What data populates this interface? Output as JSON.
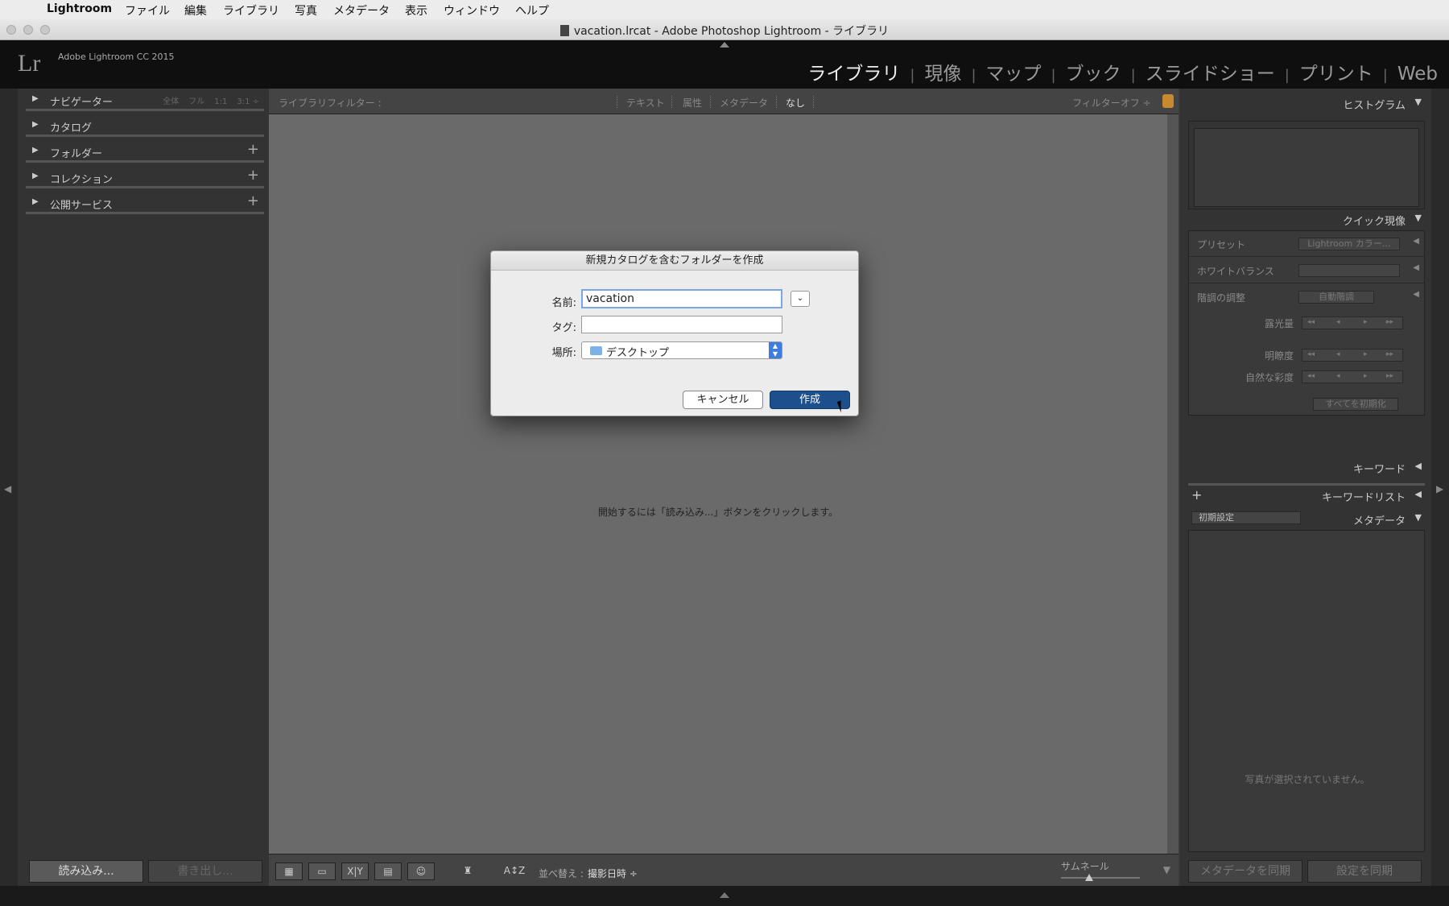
{
  "menubar": {
    "app": "Lightroom",
    "items": [
      "ファイル",
      "編集",
      "ライブラリ",
      "写真",
      "メタデータ",
      "表示",
      "ウィンドウ",
      "ヘルプ"
    ]
  },
  "window": {
    "title": "vacation.lrcat - Adobe Photoshop Lightroom - ライブラリ"
  },
  "identity": {
    "logo": "Lr",
    "version": "Adobe Lightroom CC 2015"
  },
  "modules": [
    "ライブラリ",
    "現像",
    "マップ",
    "ブック",
    "スライドショー",
    "プリント",
    "Web"
  ],
  "left": {
    "nav_label": "ナビゲーター",
    "nav_opts": [
      "全体",
      "フル",
      "1:1",
      "3:1"
    ],
    "catalog": "カタログ",
    "folder": "フォルダー",
    "collection": "コレクション",
    "publish": "公開サービス",
    "import": "読み込み...",
    "export": "書き出し..."
  },
  "filterbar": {
    "label": "ライブラリフィルター :",
    "text": "テキスト",
    "attr": "属性",
    "meta": "メタデータ",
    "none": "なし",
    "off": "フィルターオフ ÷"
  },
  "center": {
    "hint": "開始するには「読み込み...」ボタンをクリックします。"
  },
  "toolbar": {
    "sort_label": "並べ替え :",
    "sort_value": "撮影日時 ÷",
    "thumb": "サムネール"
  },
  "right": {
    "histogram": "ヒストグラム",
    "quick": "クイック現像",
    "preset": "プリセット",
    "preset_val": "Lightroom カラー…",
    "wb": "ホワイトバランス",
    "tone": "階調の調整",
    "auto": "自動階調",
    "exposure": "露光量",
    "clarity": "明瞭度",
    "vibrance": "自然な彩度",
    "reset": "すべてを初期化",
    "keywording": "キーワード",
    "keyword_list": "キーワードリスト",
    "meta_preset": "初期設定",
    "metadata": "メタデータ",
    "no_photo": "写真が選択されていません。",
    "sync_meta": "メタデータを同期",
    "sync_settings": "設定を同期"
  },
  "dialog": {
    "title": "新規カタログを含むフォルダーを作成",
    "name_label": "名前:",
    "name_value": "vacation",
    "tag_label": "タグ:",
    "tag_value": "",
    "place_label": "場所:",
    "place_value": "デスクトップ",
    "cancel": "キャンセル",
    "create": "作成"
  }
}
